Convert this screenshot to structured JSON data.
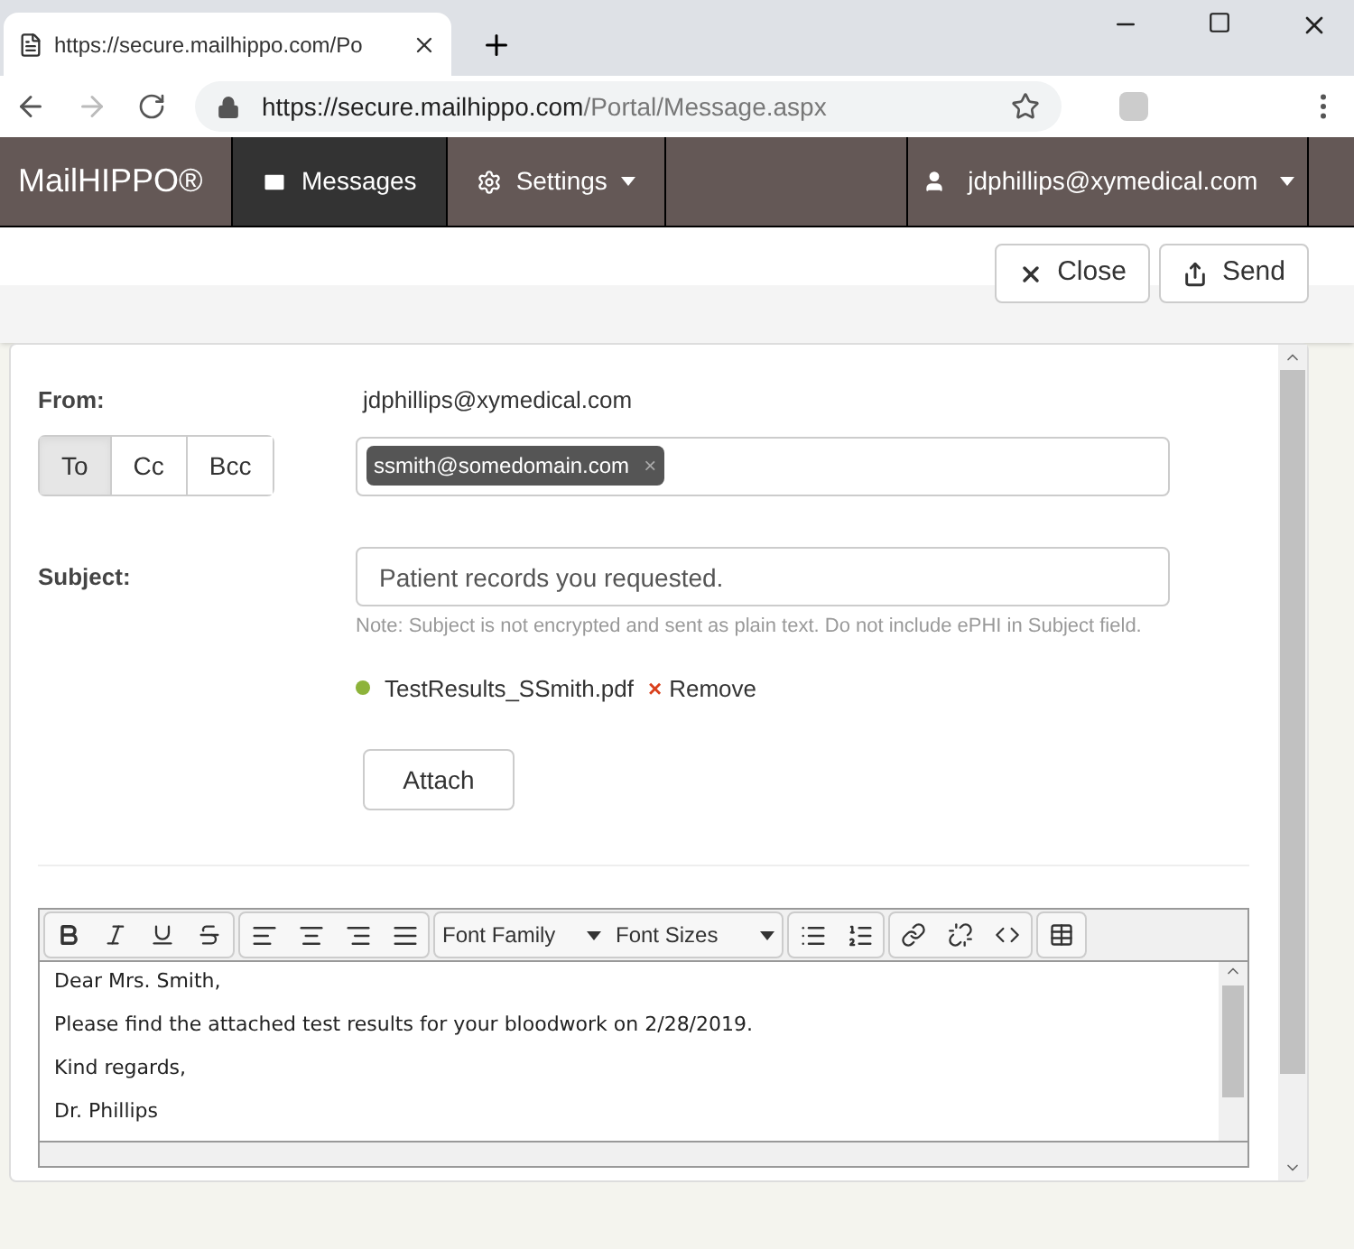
{
  "browser": {
    "tab_title": "https://secure.mailhippo.com/Po",
    "url_host": "https://secure.mailhippo.com",
    "url_path": "/Portal/Message.aspx"
  },
  "navbar": {
    "brand": "MailHIPPO®",
    "items": [
      {
        "label": "Messages",
        "selected": true,
        "dropdown": false
      },
      {
        "label": "Settings",
        "selected": false,
        "dropdown": true
      }
    ],
    "user": "jdphillips@xymedical.com"
  },
  "actions": [
    {
      "label": "Close"
    },
    {
      "label": "Send"
    }
  ],
  "form": {
    "from_label": "From:",
    "from_value": "jdphillips@xymedical.com",
    "recipient_types": [
      {
        "label": "To",
        "selected": true
      },
      {
        "label": "Cc",
        "selected": false
      },
      {
        "label": "Bcc",
        "selected": false
      }
    ],
    "recipients": [
      {
        "email": "ssmith@somedomain.com",
        "remove": "×"
      }
    ],
    "subject_label": "Subject:",
    "subject_value": "Patient records you requested.",
    "subject_note": "Note: Subject is not encrypted and sent as plain text. Do not include ePHI in Subject field.",
    "attachments": [
      {
        "name": "TestResults_SSmith.pdf",
        "remove_icon": "×",
        "remove_label": "Remove",
        "color": "#8db33a"
      }
    ],
    "attach_button": "Attach"
  },
  "editor": {
    "font_family": "Font Family",
    "font_sizes": "Font Sizes",
    "lines": [
      "Dear Mrs. Smith,",
      "Please find the attached test results for your bloodwork on 2/28/2019.",
      "Kind regards,",
      "Dr. Phillips"
    ]
  }
}
